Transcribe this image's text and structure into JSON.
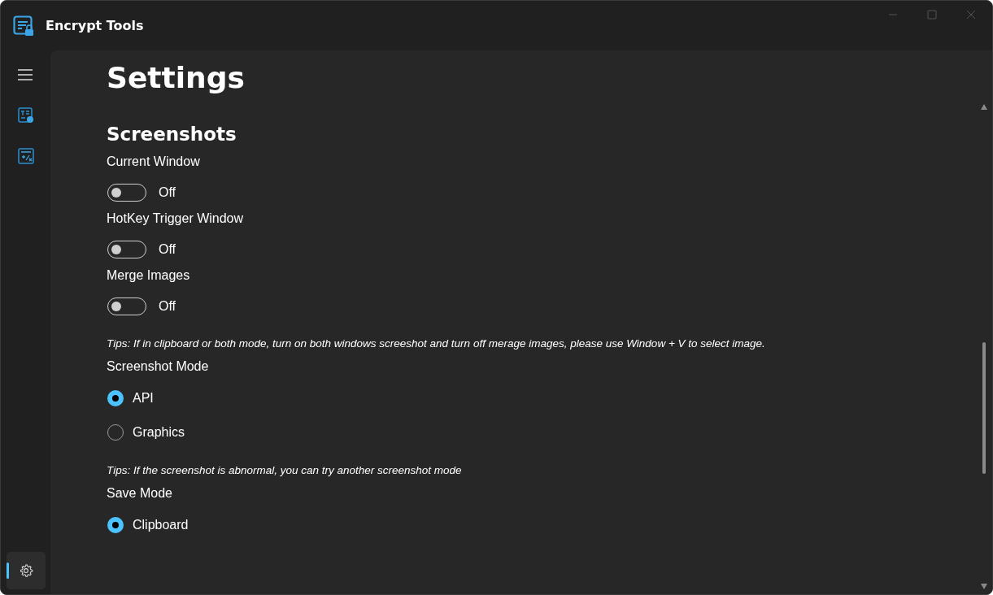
{
  "window": {
    "title": "Encrypt Tools"
  },
  "sidebar": {
    "items": [
      {
        "kind": "text-lock",
        "selected": false
      },
      {
        "kind": "hash",
        "selected": false
      }
    ],
    "settings": {
      "selected": true
    }
  },
  "page": {
    "title": "Settings",
    "section": "Screenshots",
    "items": [
      {
        "kind": "toggle",
        "label": "Current Window",
        "on": false,
        "state_text": "Off"
      },
      {
        "kind": "toggle",
        "label": "HotKey Trigger Window",
        "on": false,
        "state_text": "Off"
      },
      {
        "kind": "toggle",
        "label": "Merge Images",
        "on": false,
        "state_text": "Off"
      },
      {
        "kind": "tip",
        "text": "Tips: If in clipboard or both mode, turn on both windows screeshot and turn off merage images, please use Window + V to select image."
      },
      {
        "kind": "radio",
        "label": "Screenshot Mode",
        "options": [
          {
            "label": "API",
            "selected": true
          },
          {
            "label": "Graphics",
            "selected": false
          }
        ]
      },
      {
        "kind": "tip",
        "text": "Tips: If the screenshot is abnormal, you can try another screenshot mode"
      },
      {
        "kind": "radio",
        "label": "Save Mode",
        "options": [
          {
            "label": "Clipboard",
            "selected": true
          }
        ]
      }
    ]
  }
}
